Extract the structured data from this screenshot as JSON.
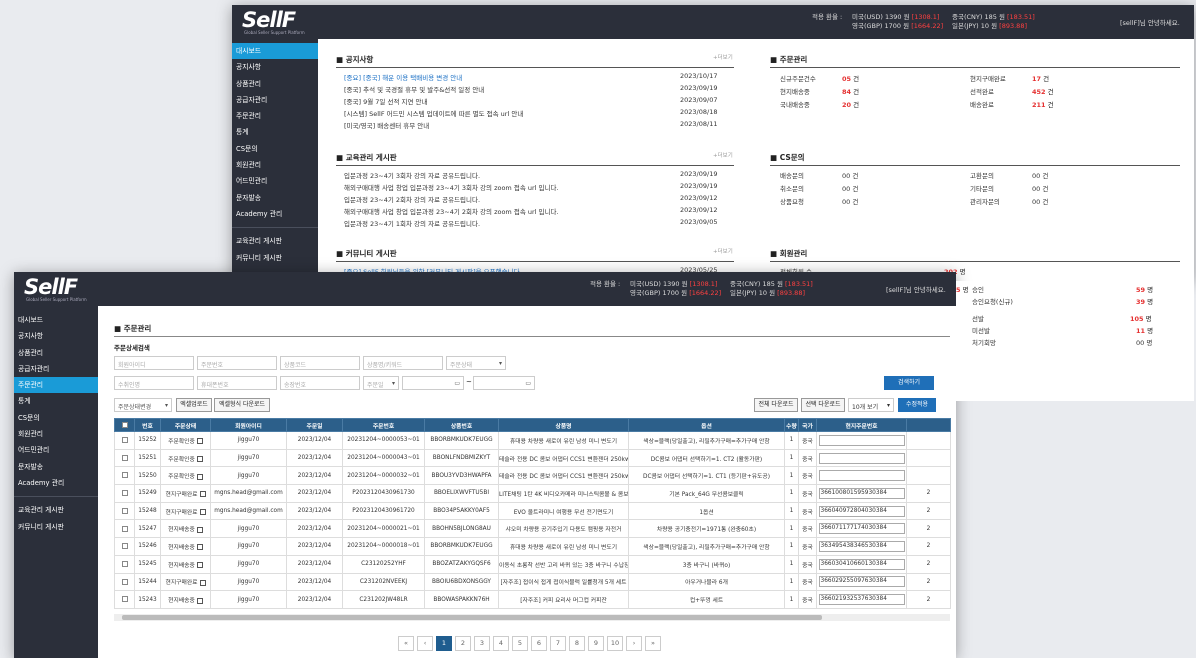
{
  "brand": {
    "logo": "SellF",
    "sub": "Global Seller Support Platform"
  },
  "rates": {
    "label": "적용 환율 :",
    "items": [
      {
        "name": "미국(USD) 1390 원",
        "delta": "[1308.1]"
      },
      {
        "name": "중국(CNY) 185 원",
        "delta": "[183.51]"
      },
      {
        "name": "영국(GBP) 1700 원",
        "delta": "[1664.22]"
      },
      {
        "name": "일본(JPY) 10 원",
        "delta": "[893.88]"
      }
    ]
  },
  "user_msg": "[sellF]님 안녕하세요.",
  "sidebar": [
    "대시보드",
    "공지사항",
    "상품관리",
    "공급자관리",
    "주문관리",
    "통계",
    "CS문의",
    "회원관리",
    "어드민관리",
    "문자발송",
    "Academy 관리",
    "교육관리 게시판",
    "커뮤니티 게시판"
  ],
  "dashboard": {
    "more": "+더보기",
    "notice": {
      "title": "공지사항",
      "rows": [
        {
          "t": "[중요] [중국] 해운 이용 택배비용 변경 안내",
          "d": "2023/10/17",
          "hl": true
        },
        {
          "t": "[중국] 추석 및 국경절 휴무 및 발주&선적 일정 안내",
          "d": "2023/09/19",
          "hl": false
        },
        {
          "t": "[중국] 9월 7일 선적 지연 안내",
          "d": "2023/09/07",
          "hl": false
        },
        {
          "t": "[시스템] SellF 어드민 시스템 업데이트에 따른 별도 접속 url 안내",
          "d": "2023/08/18",
          "hl": false
        },
        {
          "t": "[미국/영국] 배송센터 휴무 안내",
          "d": "2023/08/11",
          "hl": false
        }
      ]
    },
    "edu": {
      "title": "교육관리 게시판",
      "rows": [
        {
          "t": "입문과정 23~4기 3회차 강의 자료 공유드립니다.",
          "d": "2023/09/19"
        },
        {
          "t": "해외구매대행 사업 창업 입문과정 23~4기 3회차 강의 zoom 접속 url 입니다.",
          "d": "2023/09/19"
        },
        {
          "t": "입문과정 23~4기 2회차 강의 자료 공유드립니다.",
          "d": "2023/09/12"
        },
        {
          "t": "해외구매대행 사업 창업 입문과정 23~4기 2회차 강의 zoom 접속 url 입니다.",
          "d": "2023/09/12"
        },
        {
          "t": "입문과정 23~4기 1회차 강의 자료 공유드립니다.",
          "d": "2023/09/05"
        }
      ]
    },
    "community": {
      "title": "커뮤니티 게시판",
      "rows": [
        {
          "t": "[중요] SellF 회원님들을 위한 [커뮤니티 게시판]을 오픈했습니다",
          "d": "2023/05/25"
        }
      ]
    },
    "order": {
      "title": "주문관리",
      "items": [
        {
          "k": "신규주문건수",
          "v": "05",
          "u": "건"
        },
        {
          "k": "현지구매완료",
          "v": "17",
          "u": "건"
        },
        {
          "k": "현지배송중",
          "v": "84",
          "u": "건"
        },
        {
          "k": "선적완료",
          "v": "452",
          "u": "건"
        },
        {
          "k": "국내배송중",
          "v": "20",
          "u": "건"
        },
        {
          "k": "배송완료",
          "v": "211",
          "u": "건"
        }
      ]
    },
    "cs": {
      "title": "CS문의",
      "items": [
        {
          "k": "배송문의",
          "v": "00 건"
        },
        {
          "k": "고환문의",
          "v": "00 건"
        },
        {
          "k": "취소문의",
          "v": "00 건"
        },
        {
          "k": "기타문의",
          "v": "00 건"
        },
        {
          "k": "상품요청",
          "v": "00 건"
        },
        {
          "k": "관리자문의",
          "v": "00 건"
        }
      ]
    },
    "member": {
      "title": "회원관리",
      "total_k": "전체회원 수",
      "total_v": "202",
      "unit": "명",
      "rows": [
        {
          "k": "승인",
          "v": "59",
          "u": "명"
        },
        {
          "k": "승인요청(신규)",
          "v": "39",
          "u": "명"
        },
        {
          "pre": "5",
          "k": "선발",
          "v": "105",
          "u": "명"
        },
        {
          "k": "미선발",
          "v": "11",
          "u": "명"
        },
        {
          "k": "처기회망",
          "v": "00 명"
        }
      ],
      "pre_unit": "명"
    }
  },
  "orders": {
    "title": "주문관리",
    "subtitle": "주문상세검색",
    "fields": [
      "회원아이디",
      "주문번호",
      "상품코드",
      "상품명/키워드",
      "주문상태",
      "수취인명",
      "휴대폰번호",
      "송장번호",
      "주문일"
    ],
    "search_btn": "검색하기",
    "bulk_select": "주문상태변경",
    "buttons": {
      "excel_up": "엑셀업로드",
      "excel_form": "엑셀형식 다운로드",
      "all_down": "전체 다운로드",
      "sel_down": "선택 다운로드",
      "per_page": "10개 보기",
      "save": "수정적용"
    },
    "columns": [
      "",
      "번호",
      "주문상태",
      "회원아이디",
      "주문일",
      "주문번호",
      "상품번호",
      "상품명",
      "옵션",
      "수량",
      "국가",
      "현지주문번호",
      ""
    ],
    "rows": [
      {
        "no": "15252",
        "st": "주문확인중",
        "id": "jiggu70",
        "date": "2023/12/04",
        "ord": "20231204~0000053~01",
        "pn": "BBORBMKUDK7EUGG",
        "name": "휴대용 차량용 새로이 유린 남성 미니 변도기",
        "opt": "색상=블랙(당일출고), 리필추가구매=추가구매 안함",
        "q": "1",
        "c": "중국",
        "local": "",
        "x": ""
      },
      {
        "no": "15251",
        "st": "주문확인중",
        "id": "jiggu70",
        "date": "2023/12/04",
        "ord": "20231204~0000043~01",
        "pn": "BBONLFNDBMIZKYT",
        "name": "테슬라 전용 DC 콤보 어댑터 CCS1 변환젠더 250kw",
        "opt": "DC콤보 어댑터 선택하기=1. CT2 (활동가판)",
        "q": "1",
        "c": "중국",
        "local": "",
        "x": ""
      },
      {
        "no": "15250",
        "st": "주문확인중",
        "id": "jiggu70",
        "date": "2023/12/04",
        "ord": "20231204~0000032~01",
        "pn": "BBOU3YVD3HWAPFA",
        "name": "테슬라 전용 DC 콤보 어댑터 CCS1 변환젠더 250kw",
        "opt": "DC콤보 어댑터 선택하기=1. CT1 (등기판+유도공)",
        "q": "1",
        "c": "중국",
        "local": "",
        "x": ""
      },
      {
        "no": "15249",
        "st": "현지구매완료",
        "id": "mgns.head@gmail.com",
        "date": "2023/12/04",
        "ord": "P2023120430961730",
        "pn": "BBOELIXWVFTU5BI",
        "name": "LITE채팅 1탄 4K 비디오카메라 미니스틱콤볼 & 콤보클릭 세트",
        "opt": "기본 Pack_64G 무선콤보클릭",
        "q": "1",
        "c": "중국",
        "local": "366100801595930384",
        "x": "2"
      },
      {
        "no": "15248",
        "st": "현지구매완료",
        "id": "mgns.head@gmail.com",
        "date": "2023/12/04",
        "ord": "P2023120430961720",
        "pn": "BBO34P5AKKY0AF5",
        "name": "EVO 울트라미니 여행용 무선 전기면도기",
        "opt": "1옵션",
        "q": "1",
        "c": "중국",
        "local": "366040972804030384",
        "x": "2"
      },
      {
        "no": "15247",
        "st": "현지배송중",
        "id": "jiggu70",
        "date": "2023/12/04",
        "ord": "20231204~0000021~01",
        "pn": "BBOHN5BJLONG8AU",
        "name": "샤오미 차량용 공기주입기 다용도 캠핑용 자전거",
        "opt": "차량용 공기충전기=1971통 (완충60초)",
        "q": "1",
        "c": "중국",
        "local": "366071177174030384",
        "x": "2"
      },
      {
        "no": "15246",
        "st": "현지배송중",
        "id": "jiggu70",
        "date": "2023/12/04",
        "ord": "20231204~0000018~01",
        "pn": "BBORBMKUDK7EUGG",
        "name": "휴대용 차량용 새로이 유린 남성 미니 변도기",
        "opt": "색상=블랙(당일출고), 리필추가구매=추가구매 안함",
        "q": "1",
        "c": "중국",
        "local": "363495438346530384",
        "x": "2"
      },
      {
        "no": "15245",
        "st": "현지배송중",
        "id": "jiggu70",
        "date": "2023/12/04",
        "ord": "C23120252YHF",
        "pn": "BBOZATZAKYGQSF6",
        "name": "이동식 초롱착 선반 고리 바퀴 있는 3층 바구니 수납장",
        "opt": "3층 바구니 (바퀴o)",
        "q": "1",
        "c": "중국",
        "local": "366030410660130384",
        "x": "2"
      },
      {
        "no": "15244",
        "st": "현지구매완료",
        "id": "jiggu70",
        "date": "2023/12/04",
        "ord": "C231202NVEEKJ",
        "pn": "BBOIU6BDXONSGGY",
        "name": "[자주조] 접이식 접게 접이식블럭 일률청개 5개 세트",
        "opt": "아우거나블라 6개",
        "q": "1",
        "c": "중국",
        "local": "366029255097630384",
        "x": "2"
      },
      {
        "no": "15243",
        "st": "현지배송중",
        "id": "jiggu70",
        "date": "2023/12/04",
        "ord": "C231202JW48LR",
        "pn": "BBOWASPAKKN76H",
        "name": "[자주조] 커피 요리사 머그컵 커피잔",
        "opt": "컵+뚜껑 세트",
        "q": "1",
        "c": "중국",
        "local": "366021932537630384",
        "x": "2"
      }
    ],
    "pages": [
      "«",
      "‹",
      "1",
      "2",
      "3",
      "4",
      "5",
      "6",
      "7",
      "8",
      "9",
      "10",
      "›",
      "»"
    ]
  }
}
